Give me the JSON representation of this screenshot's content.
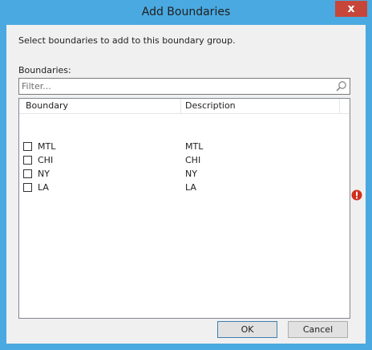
{
  "window": {
    "title": "Add Boundaries",
    "close_glyph": "x"
  },
  "instruction": "Select boundaries to add to this boundary group.",
  "boundaries_label": "Boundaries:",
  "filter": {
    "placeholder": "Filter...",
    "value": "",
    "icon": "search-icon"
  },
  "table": {
    "columns": [
      "Boundary",
      "Description"
    ],
    "rows": [
      {
        "boundary": "MTL",
        "description": "MTL",
        "checked": false
      },
      {
        "boundary": "CHI",
        "description": "CHI",
        "checked": false
      },
      {
        "boundary": "NY",
        "description": "NY",
        "checked": false
      },
      {
        "boundary": "LA",
        "description": "LA",
        "checked": false
      }
    ]
  },
  "status_icon": "error-icon",
  "buttons": {
    "ok": "OK",
    "cancel": "Cancel"
  },
  "colors": {
    "title_bar": "#4aa9e0",
    "close_button": "#c7463a",
    "error": "#d0301d"
  }
}
